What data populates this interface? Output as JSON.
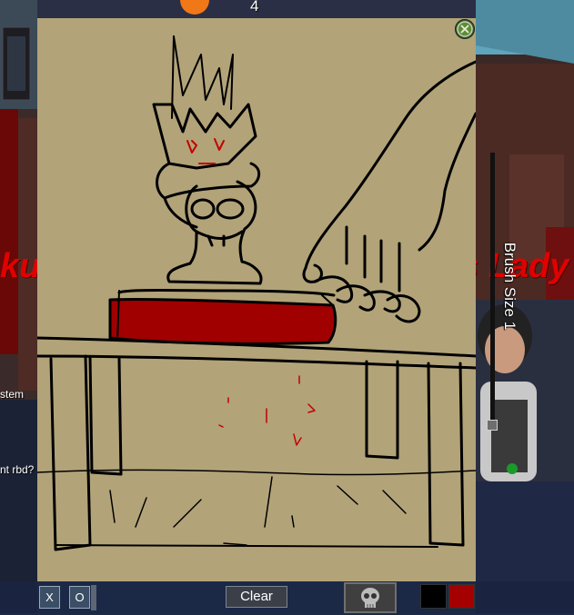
{
  "hud": {
    "score": "4"
  },
  "background": {
    "chat_system_fragment": "stem",
    "chat_message_fragment": "nt rbd?",
    "name_left_fragment": "ku",
    "name_right_fragment": "s Lady"
  },
  "canvas": {
    "color": "#b2a379",
    "stroke_color_primary": "#000000",
    "stroke_color_secondary": "#c30000"
  },
  "brush": {
    "label": "Brush Size 1",
    "size": 1
  },
  "toolbar": {
    "x_label": "X",
    "o_label": "O",
    "clear_label": "Clear",
    "skull_icon": "skull-icon",
    "swatches": [
      {
        "name": "black",
        "color": "#000000"
      },
      {
        "name": "red",
        "color": "#a50000"
      }
    ]
  },
  "window": {
    "close_icon": "close-icon"
  }
}
